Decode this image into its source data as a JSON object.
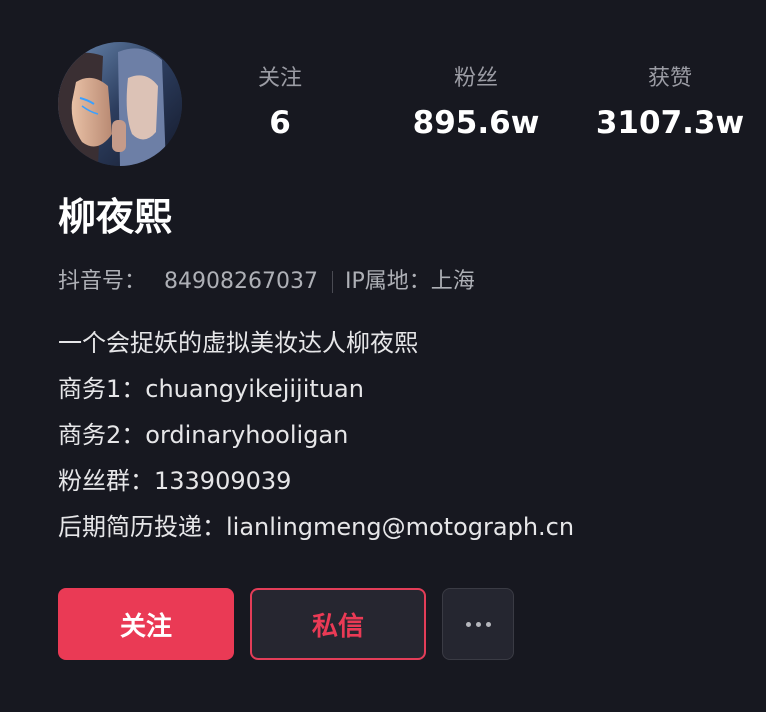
{
  "profile": {
    "name": "柳夜熙",
    "douyin_id_label": "抖音号：",
    "douyin_id": "84908267037",
    "ip_location": "IP属地：上海"
  },
  "stats": [
    {
      "label": "关注",
      "value": "6"
    },
    {
      "label": "粉丝",
      "value": "895.6w"
    },
    {
      "label": "获赞",
      "value": "3107.3w"
    }
  ],
  "bio": {
    "lines": [
      "一个会捉妖的虚拟美妆达人柳夜熙",
      "商务1：chuangyikejijituan",
      "商务2：ordinaryhooligan",
      "粉丝群：133909039",
      "后期简历投递：lianlingmeng@motograph.cn"
    ]
  },
  "actions": {
    "follow_label": "关注",
    "message_label": "私信",
    "more_icon": "more-dots-icon"
  },
  "colors": {
    "background": "#171820",
    "accent": "#ea3a55"
  }
}
